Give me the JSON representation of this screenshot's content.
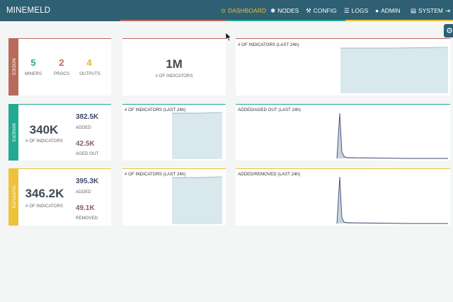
{
  "app": {
    "brand": "MINEMELD",
    "nav": [
      {
        "icon": "dashboard-icon",
        "glyph": "⊙",
        "label": "DASHBOARD",
        "active": true
      },
      {
        "icon": "nodes-icon",
        "glyph": "✱",
        "label": "NODES"
      },
      {
        "icon": "config-icon",
        "glyph": "🔧",
        "label": "CONFIG"
      },
      {
        "icon": "logs-icon",
        "glyph": "☰",
        "label": "LOGS"
      },
      {
        "icon": "admin-icon",
        "glyph": "👤",
        "label": "ADMIN"
      },
      {
        "icon": "system-icon",
        "glyph": "🖴",
        "label": "SYSTEM"
      },
      {
        "icon": "logout-icon",
        "glyph": "⇥",
        "label": ""
      }
    ]
  },
  "colors": {
    "nav_bg": "#2e5f73",
    "active": "#e6c23a",
    "nodes": "#b86a5b",
    "miners": "#22a992",
    "outputs": "#eec23a",
    "area_fill": "#d9e8ec",
    "area_line": "#9cb8c4",
    "spike": "#3e4d6b"
  },
  "nodes": {
    "side_label": "NODES",
    "miners": {
      "value": "5",
      "label": "MINERS"
    },
    "procs": {
      "value": "2",
      "label": "PROCS"
    },
    "outputs": {
      "value": "4",
      "label": "OUTPUTS"
    },
    "indicators": {
      "value": "1M",
      "label": "# OF INDICATORS"
    },
    "chart_title": "# OF INDICATORS (LAST 24h)"
  },
  "miners": {
    "side_label": "MINERS",
    "total": {
      "value": "340K",
      "label": "# OF INDICATORS"
    },
    "added": {
      "value": "382.5K",
      "label": "ADDED"
    },
    "aged_out": {
      "value": "42.5K",
      "label": "AGED OUT"
    },
    "chart1_title": "# OF INDICATORS (LAST 24h)",
    "chart2_title": "ADDED/AGED OUT (LAST 24h)"
  },
  "outputs": {
    "side_label": "OUTPUTS",
    "total": {
      "value": "346.2K",
      "label": "# OF INDICATORS"
    },
    "added": {
      "value": "395.3K",
      "label": "ADDED"
    },
    "removed": {
      "value": "49.1K",
      "label": "REMOVED"
    },
    "chart1_title": "# OF INDICATORS (LAST 24h)",
    "chart2_title": "ADDED/REMOVED (LAST 24h)"
  }
}
